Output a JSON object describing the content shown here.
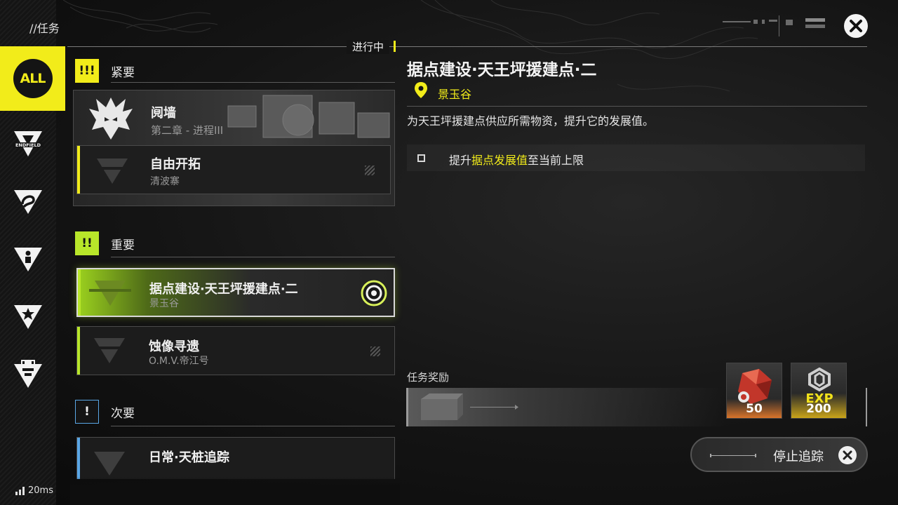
{
  "header": {
    "title": "//任务",
    "status_tag": "进行中"
  },
  "sidebar": {
    "items": [
      {
        "key": "all",
        "label": "ALL",
        "icon": "all-icon",
        "active": true
      },
      {
        "key": "endfield",
        "label": "ENDFIELD",
        "icon": "endfield-triangle-icon"
      },
      {
        "key": "explore",
        "icon": "explore-triangle-icon"
      },
      {
        "key": "character",
        "icon": "character-triangle-icon"
      },
      {
        "key": "star",
        "icon": "star-triangle-icon"
      },
      {
        "key": "outpost",
        "icon": "outpost-triangle-icon"
      }
    ]
  },
  "quest_list": {
    "urgent": {
      "label": "紧要",
      "icon_text": "!!!",
      "cards": [
        {
          "name": "阋墙",
          "sub": "第二章 - 进程III"
        },
        {
          "name": "自由开拓",
          "sub": "清波寨"
        }
      ]
    },
    "important": {
      "label": "重要",
      "icon_text": "!!",
      "cards": [
        {
          "name": "据点建设·天王坪援建点·二",
          "sub": "景玉谷",
          "tracked": true
        },
        {
          "name": "蚀像寻遗",
          "sub": "O.M.V.帝江号"
        }
      ]
    },
    "secondary": {
      "label": "次要",
      "icon_text": "!",
      "cards": [
        {
          "name": "日常·天桩追踪"
        }
      ]
    }
  },
  "detail": {
    "title": "据点建设·天王坪援建点·二",
    "location": "景玉谷",
    "description": "为天王坪援建点供应所需物资，提升它的发展值。",
    "objective": {
      "prefix": "提升",
      "highlight": "据点发展值",
      "suffix": "至当前上限"
    },
    "rewards_label": "任务奖励",
    "rewards": [
      {
        "icon": "red-crystal-icon",
        "amount": "50"
      },
      {
        "icon": "exp-icon",
        "label": "EXP",
        "amount": "200"
      }
    ],
    "stop_tracking": "停止追踪"
  },
  "status": {
    "ping": "20ms"
  },
  "colors": {
    "accent_yellow": "#f2ec1a",
    "important_green": "#b8e62a",
    "secondary_blue": "#5aa7e6"
  }
}
